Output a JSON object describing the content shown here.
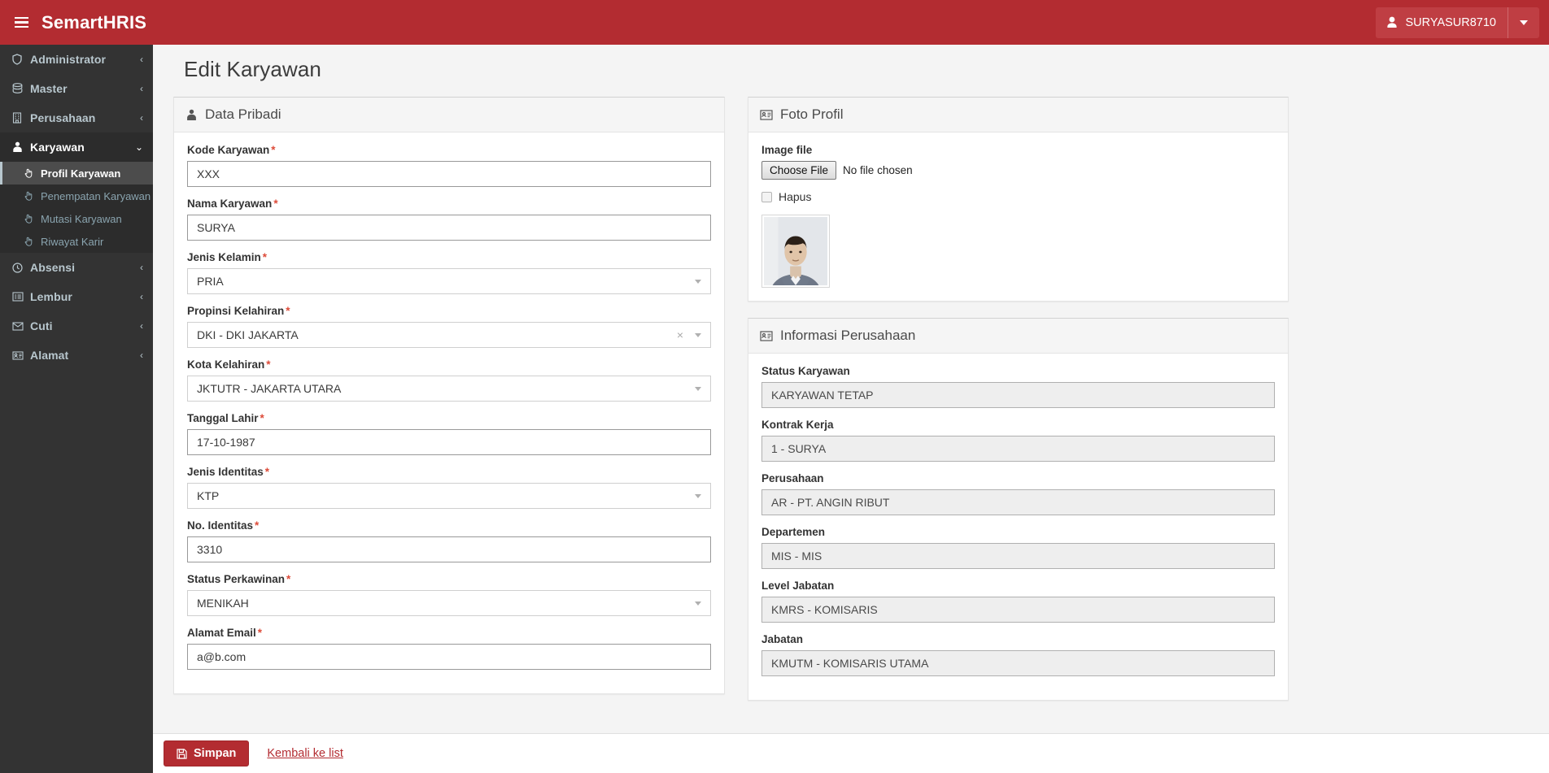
{
  "header": {
    "brand": "SemartHRIS",
    "menu_icon": "hamburger-icon",
    "user": {
      "name": "SURYASUR8710",
      "icon": "user-icon",
      "caret": "caret-down-icon"
    }
  },
  "colors": {
    "brand_red": "#b32c31",
    "sidebar_dark": "#333333",
    "sidebar_active": "#4c4c4c",
    "required_star": "#dd4b39",
    "page_bg": "#f4f4f4"
  },
  "sidebar": {
    "items": [
      {
        "label": "Administrator",
        "icon": "shield-icon",
        "arrow": "‹",
        "expanded": false
      },
      {
        "label": "Master",
        "icon": "database-icon",
        "arrow": "‹",
        "expanded": false
      },
      {
        "label": "Perusahaan",
        "icon": "building-icon",
        "arrow": "‹",
        "expanded": false
      },
      {
        "label": "Karyawan",
        "icon": "user-tie-icon",
        "arrow": "⌄",
        "expanded": true
      },
      {
        "label": "Absensi",
        "icon": "clock-icon",
        "arrow": "‹",
        "expanded": false
      },
      {
        "label": "Lembur",
        "icon": "list-icon",
        "arrow": "‹",
        "expanded": false
      },
      {
        "label": "Cuti",
        "icon": "envelope-icon",
        "arrow": "‹",
        "expanded": false
      },
      {
        "label": "Alamat",
        "icon": "vcard-icon",
        "arrow": "‹",
        "expanded": false
      }
    ],
    "karyawan_submenu": [
      {
        "label": "Profil Karyawan",
        "icon": "hand-pointer-icon",
        "active": true
      },
      {
        "label": "Penempatan Karyawan",
        "icon": "hand-pointer-icon",
        "active": false
      },
      {
        "label": "Mutasi Karyawan",
        "icon": "hand-pointer-icon",
        "active": false
      },
      {
        "label": "Riwayat Karir",
        "icon": "hand-pointer-icon",
        "active": false
      }
    ]
  },
  "page": {
    "title": "Edit Karyawan"
  },
  "data_pribadi": {
    "panel_title": "Data Pribadi",
    "panel_icon": "user-tie-icon",
    "fields": [
      {
        "label": "Kode Karyawan",
        "required": true,
        "type": "text",
        "value": "XXX"
      },
      {
        "label": "Nama Karyawan",
        "required": true,
        "type": "text",
        "value": "SURYA"
      },
      {
        "label": "Jenis Kelamin",
        "required": true,
        "type": "select",
        "value": "PRIA",
        "clearable": false
      },
      {
        "label": "Propinsi Kelahiran",
        "required": true,
        "type": "select",
        "value": "DKI - DKI JAKARTA",
        "clearable": true,
        "clear_glyph": "×"
      },
      {
        "label": "Kota Kelahiran",
        "required": true,
        "type": "select",
        "value": "JKTUTR - JAKARTA UTARA",
        "clearable": false
      },
      {
        "label": "Tanggal Lahir",
        "required": true,
        "type": "text",
        "value": "17-10-1987"
      },
      {
        "label": "Jenis Identitas",
        "required": true,
        "type": "select",
        "value": "KTP",
        "clearable": false
      },
      {
        "label": "No. Identitas",
        "required": true,
        "type": "text",
        "value": "3310"
      },
      {
        "label": "Status Perkawinan",
        "required": true,
        "type": "select",
        "value": "MENIKAH",
        "clearable": false
      },
      {
        "label": "Alamat Email",
        "required": true,
        "type": "text",
        "value": "a@b.com"
      }
    ]
  },
  "foto_profil": {
    "panel_title": "Foto Profil",
    "panel_icon": "vcard-icon",
    "image_file_label": "Image file",
    "choose_file_label": "Choose File",
    "no_file_text": "No file chosen",
    "hapus_label": "Hapus",
    "hapus_checked": false,
    "photo_alt": "employee-photo"
  },
  "informasi_perusahaan": {
    "panel_title": "Informasi Perusahaan",
    "panel_icon": "vcard-icon",
    "fields": [
      {
        "label": "Status Karyawan",
        "value": "KARYAWAN TETAP",
        "readonly": true
      },
      {
        "label": "Kontrak Kerja",
        "value": "1 - SURYA",
        "readonly": true
      },
      {
        "label": "Perusahaan",
        "value": "AR - PT. ANGIN RIBUT",
        "readonly": true
      },
      {
        "label": "Departemen",
        "value": "MIS - MIS",
        "readonly": true
      },
      {
        "label": "Level Jabatan",
        "value": "KMRS - KOMISARIS",
        "readonly": true
      },
      {
        "label": "Jabatan",
        "value": "KMUTM - KOMISARIS UTAMA",
        "readonly": true
      }
    ]
  },
  "footer": {
    "save_label": "Simpan",
    "save_icon": "floppy-save-icon",
    "back_link_label": "Kembali ke list"
  }
}
